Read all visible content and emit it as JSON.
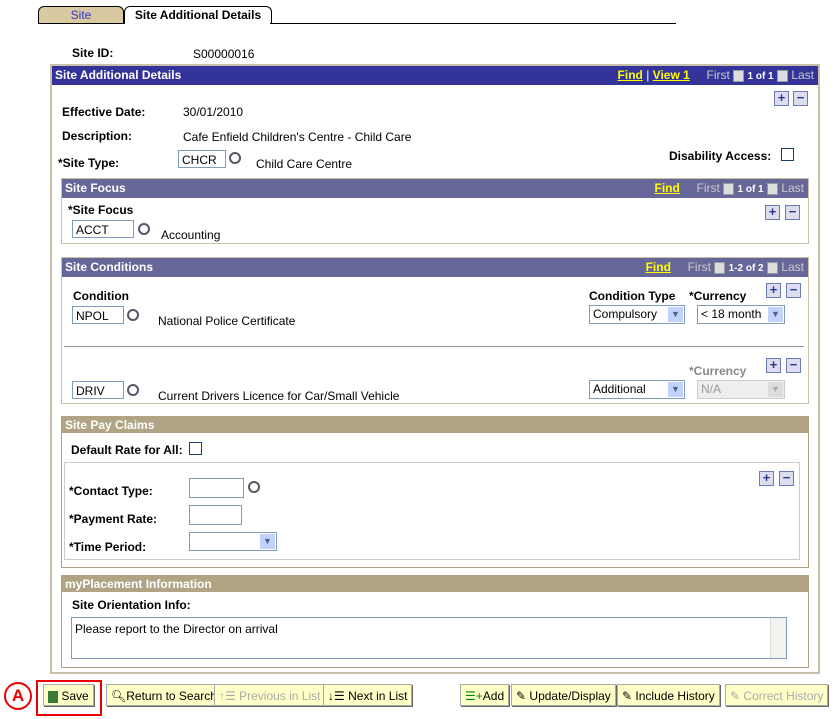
{
  "tabs": [
    {
      "label": "Site"
    },
    {
      "label": "Site Additional Details"
    }
  ],
  "site_id": {
    "label": "Site ID:",
    "value": "S00000016"
  },
  "main": {
    "title": "Site Additional Details",
    "find": "Find",
    "view": "View 1",
    "first": "First",
    "count": "1 of 1",
    "last": "Last",
    "effective_date_label": "Effective Date:",
    "effective_date": "30/01/2010",
    "description_label": "Description:",
    "description": "Cafe Enfield Children's Centre - Child Care",
    "site_type_label": "*Site Type:",
    "site_type": "CHCR",
    "site_type_desc": "Child Care Centre",
    "disability_label": "Disability Access:"
  },
  "site_focus": {
    "title": "Site Focus",
    "find": "Find",
    "first": "First",
    "count": "1 of 1",
    "last": "Last",
    "field_label": "*Site Focus",
    "value": "ACCT",
    "desc": "Accounting"
  },
  "site_conditions": {
    "title": "Site Conditions",
    "find": "Find",
    "first": "First",
    "count": "1-2 of 2",
    "last": "Last",
    "condition_label": "Condition",
    "type_label": "Condition Type",
    "currency_label": "*Currency",
    "rows": [
      {
        "code": "NPOL",
        "desc": "National Police Certificate",
        "type": "Compulsory",
        "currency": "< 18 month"
      },
      {
        "code": "DRIV",
        "desc": "Current Drivers Licence for Car/Small Vehicle",
        "type": "Additional",
        "currency": "N/A"
      }
    ]
  },
  "pay_claims": {
    "title": "Site Pay Claims",
    "default_rate_label": "Default Rate for All:",
    "contact_type_label": "*Contact Type:",
    "payment_rate_label": "*Payment Rate:",
    "time_period_label": "*Time Period:"
  },
  "placement": {
    "title": "myPlacement Information",
    "orientation_label": "Site Orientation Info:",
    "orientation_text": "Please report to the Director on arrival"
  },
  "annotation": "A",
  "toolbar": {
    "save": "Save",
    "return": "Return to Search",
    "previous": "Previous in List",
    "next": "Next in List",
    "add": "Add",
    "update": "Update/Display",
    "include": "Include History",
    "correct": "Correct History"
  }
}
